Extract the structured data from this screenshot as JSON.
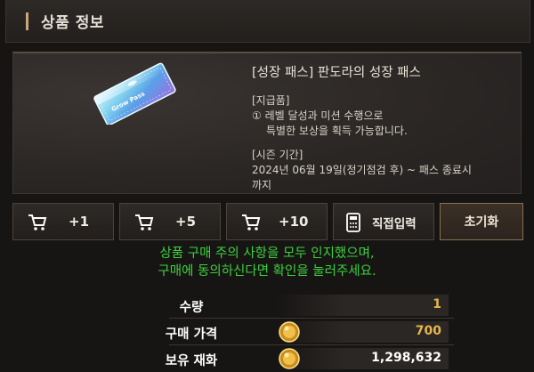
{
  "header": {
    "title": "상품 정보"
  },
  "product": {
    "name": "[성장 패스] 판도라의 성장 패스",
    "ticket_text": "Grow Pass",
    "reward_heading": "[지급품]",
    "reward_line1": "① 레벨 달성과 미션 수행으로",
    "reward_line2": "특별한 보상을 획득 가능합니다.",
    "season_heading": "[시즌 기간]",
    "season_line1": "2024년 06월 19일(정기점검 후) ~ 패스 종료시",
    "season_line2": "까지"
  },
  "buttons": {
    "plus1": "+1",
    "plus5": "+5",
    "plus10": "+10",
    "direct": "직접입력",
    "reset": "초기화"
  },
  "icons": {
    "cart": "cart-icon",
    "calculator": "calculator-icon",
    "coin": "gold-coin-icon",
    "ticket": "grow-pass-ticket"
  },
  "notice": {
    "line1": "상품 구매 주의 사항을 모두 인지했으며,",
    "line2": "구매에 동의하신다면 확인을 눌러주세요."
  },
  "summary": {
    "quantity_label": "수량",
    "quantity_value": "1",
    "price_label": "구매 가격",
    "price_value": "700",
    "owned_label": "보유 재화",
    "owned_value": "1,298,632"
  },
  "colors": {
    "notice": "#3cd13e",
    "value_gold": "#e8b64a",
    "value_white": "#ffffff",
    "accent": "#c9a77a"
  }
}
